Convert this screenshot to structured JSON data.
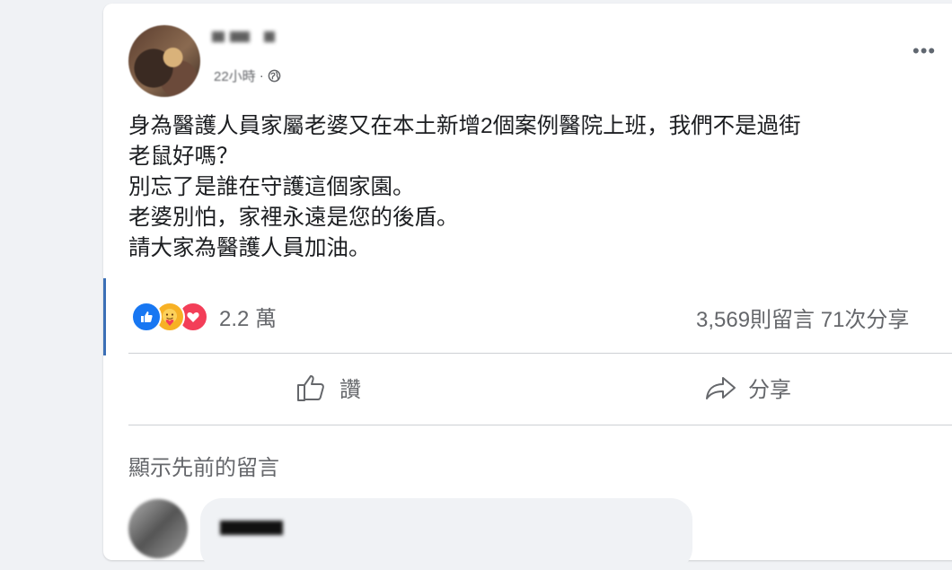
{
  "post": {
    "time_label": "22小時",
    "separator": "·",
    "more_icon": "•••",
    "text_lines": [
      "身為醫護人員家屬老婆又在本土新增2個案例醫院上班，我們不是過街",
      "老鼠好嗎？",
      "別忘了是誰在守護這個家園。",
      "老婆別怕，家裡永遠是您的後盾。",
      "請大家為醫護人員加油。"
    ],
    "reaction_count": "2.2 萬",
    "stats": "3,569則留言  71次分享"
  },
  "actions": {
    "like_label": "讚",
    "share_label": "分享"
  },
  "comments": {
    "previous_label": "顯示先前的留言"
  },
  "colors": {
    "like_blue": "#1877f2",
    "care_yellow": "#f7b125",
    "love_red": "#f33e58",
    "secondary_text": "#65676b"
  }
}
